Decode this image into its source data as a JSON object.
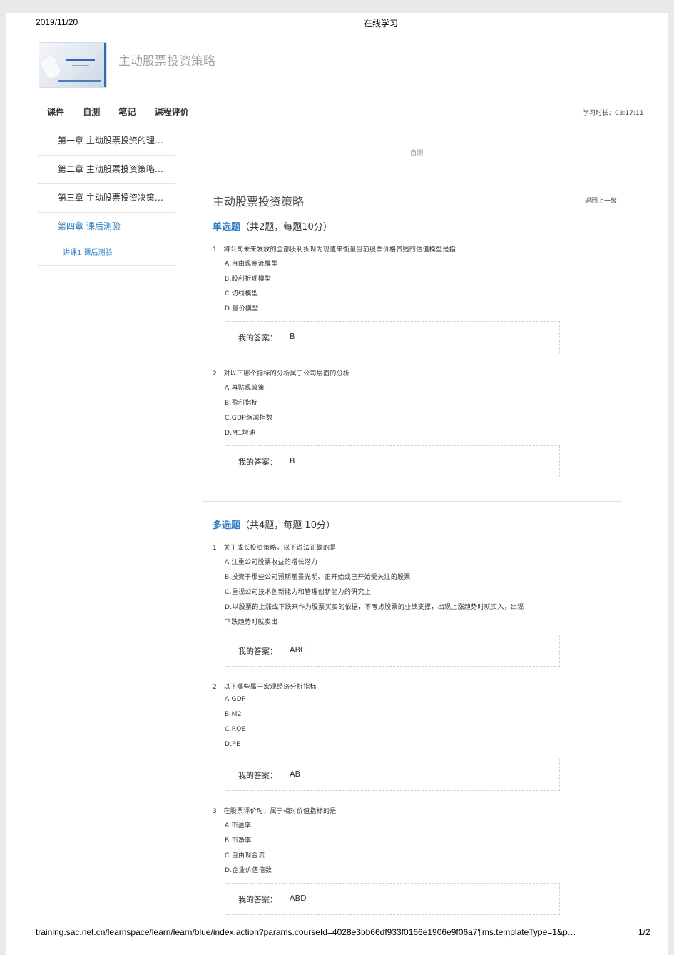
{
  "print_header": {
    "date": "2019/11/20",
    "title": "在线学习"
  },
  "course": {
    "title": "主动股票投资策略"
  },
  "tabs": [
    "课件",
    "自测",
    "笔记",
    "课程评价"
  ],
  "study_time": "学习时长：03:17:11",
  "sidebar": {
    "items": [
      {
        "label": "第一章 主动股票投资的理…"
      },
      {
        "label": "第二章 主动股票投资策略…"
      },
      {
        "label": "第三章 主动股票投资决策…"
      },
      {
        "label": "第四章 课后测验"
      }
    ],
    "sub_item": "讲课1 课后测验"
  },
  "breadcrumb": "自测",
  "main": {
    "title": "主动股票投资策略",
    "back_label": "返回上一级"
  },
  "answer_label": "我的答案：",
  "sections": [
    {
      "title": "单选题",
      "meta": "（共2题，每题10分）",
      "questions": [
        {
          "text": "1 . 将公司未来发放的全部股利折现为现值来衡量当前股票价格贵贱的估值模型是指",
          "options": [
            "A.自由现金流模型",
            "B.股利折现模型",
            "C.切线模型",
            "D.量价模型"
          ],
          "answer": "B"
        },
        {
          "text": "2 . 对以下哪个指标的分析属于公司层面的分析",
          "options": [
            "A.再贴现政策",
            "B.盈利指标",
            "C.GDP缩减指数",
            "D.M1增速"
          ],
          "answer": "B"
        }
      ]
    },
    {
      "title": "多选题",
      "meta": "（共4题，每题 10分）",
      "questions": [
        {
          "text": "1 . 关于成长投资策略，以下说法正确的是",
          "options": [
            "A.注重公司股票收益的增长潜力",
            "B.投资于那些公司预期前景光明、正开始或已开始受关注的股票",
            "C.重视公司技术创新能力和管理创新能力的研究上",
            "D.以股票的上涨或下跌来作为股票买卖的依据，不考虑股票的业绩支撑，出现上涨趋势时就买入，出现",
            "下跌趋势时就卖出"
          ],
          "answer": "ABC"
        },
        {
          "text": "2 . 以下哪些属于宏观经济分析指标",
          "options": [
            "A.GDP",
            "B.M2",
            "C.ROE",
            "D.PE"
          ],
          "answer": "AB"
        },
        {
          "text": "3 . 在股票评价时，属于相对价值指标的是",
          "options": [
            "A.市盈率",
            "B.市净率",
            "C.自由现金流",
            "D.企业价值倍数"
          ],
          "answer": "ABD"
        }
      ]
    }
  ],
  "footer": {
    "url": "training.sac.net.cn/learnspace/learn/learn/blue/index.action?params.courseId=4028e3bb66df933f0166e1906e9f06a7¶ms.templateType=1&p…",
    "page": "1/2"
  }
}
